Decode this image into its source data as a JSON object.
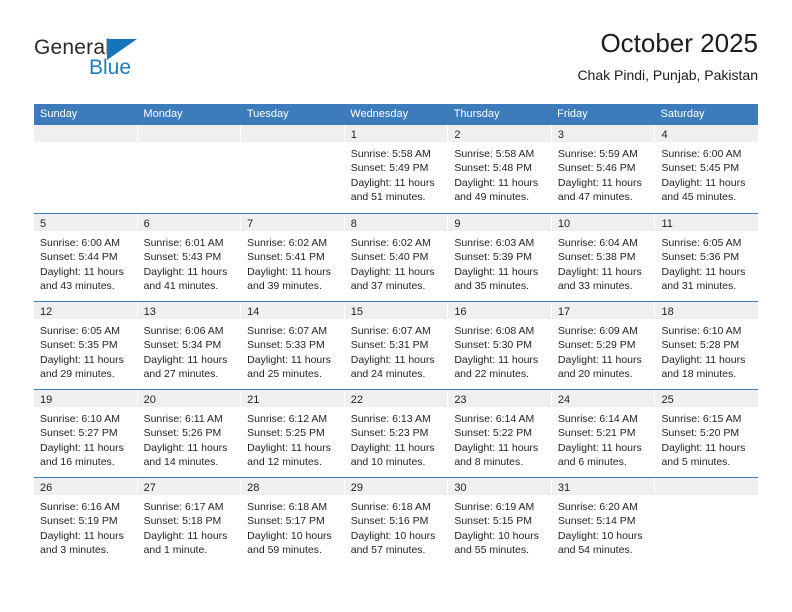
{
  "brand": {
    "line1": "General",
    "line2": "Blue",
    "triangle_color": "#1574bb",
    "blue_color": "#1a7fc1"
  },
  "header": {
    "title": "October 2025",
    "subtitle": "Chak Pindi, Punjab, Pakistan"
  },
  "theme": {
    "header_row_bg": "#3d7cba",
    "day_number_bg": "#efefef",
    "week_divider": "#3d7cba",
    "text": "#231f20"
  },
  "weekdays": [
    "Sunday",
    "Monday",
    "Tuesday",
    "Wednesday",
    "Thursday",
    "Friday",
    "Saturday"
  ],
  "weeks": [
    [
      {
        "day": "",
        "sunrise": "",
        "sunset": "",
        "daylight1": "",
        "daylight2": ""
      },
      {
        "day": "",
        "sunrise": "",
        "sunset": "",
        "daylight1": "",
        "daylight2": ""
      },
      {
        "day": "",
        "sunrise": "",
        "sunset": "",
        "daylight1": "",
        "daylight2": ""
      },
      {
        "day": "1",
        "sunrise": "Sunrise: 5:58 AM",
        "sunset": "Sunset: 5:49 PM",
        "daylight1": "Daylight: 11 hours",
        "daylight2": "and 51 minutes."
      },
      {
        "day": "2",
        "sunrise": "Sunrise: 5:58 AM",
        "sunset": "Sunset: 5:48 PM",
        "daylight1": "Daylight: 11 hours",
        "daylight2": "and 49 minutes."
      },
      {
        "day": "3",
        "sunrise": "Sunrise: 5:59 AM",
        "sunset": "Sunset: 5:46 PM",
        "daylight1": "Daylight: 11 hours",
        "daylight2": "and 47 minutes."
      },
      {
        "day": "4",
        "sunrise": "Sunrise: 6:00 AM",
        "sunset": "Sunset: 5:45 PM",
        "daylight1": "Daylight: 11 hours",
        "daylight2": "and 45 minutes."
      }
    ],
    [
      {
        "day": "5",
        "sunrise": "Sunrise: 6:00 AM",
        "sunset": "Sunset: 5:44 PM",
        "daylight1": "Daylight: 11 hours",
        "daylight2": "and 43 minutes."
      },
      {
        "day": "6",
        "sunrise": "Sunrise: 6:01 AM",
        "sunset": "Sunset: 5:43 PM",
        "daylight1": "Daylight: 11 hours",
        "daylight2": "and 41 minutes."
      },
      {
        "day": "7",
        "sunrise": "Sunrise: 6:02 AM",
        "sunset": "Sunset: 5:41 PM",
        "daylight1": "Daylight: 11 hours",
        "daylight2": "and 39 minutes."
      },
      {
        "day": "8",
        "sunrise": "Sunrise: 6:02 AM",
        "sunset": "Sunset: 5:40 PM",
        "daylight1": "Daylight: 11 hours",
        "daylight2": "and 37 minutes."
      },
      {
        "day": "9",
        "sunrise": "Sunrise: 6:03 AM",
        "sunset": "Sunset: 5:39 PM",
        "daylight1": "Daylight: 11 hours",
        "daylight2": "and 35 minutes."
      },
      {
        "day": "10",
        "sunrise": "Sunrise: 6:04 AM",
        "sunset": "Sunset: 5:38 PM",
        "daylight1": "Daylight: 11 hours",
        "daylight2": "and 33 minutes."
      },
      {
        "day": "11",
        "sunrise": "Sunrise: 6:05 AM",
        "sunset": "Sunset: 5:36 PM",
        "daylight1": "Daylight: 11 hours",
        "daylight2": "and 31 minutes."
      }
    ],
    [
      {
        "day": "12",
        "sunrise": "Sunrise: 6:05 AM",
        "sunset": "Sunset: 5:35 PM",
        "daylight1": "Daylight: 11 hours",
        "daylight2": "and 29 minutes."
      },
      {
        "day": "13",
        "sunrise": "Sunrise: 6:06 AM",
        "sunset": "Sunset: 5:34 PM",
        "daylight1": "Daylight: 11 hours",
        "daylight2": "and 27 minutes."
      },
      {
        "day": "14",
        "sunrise": "Sunrise: 6:07 AM",
        "sunset": "Sunset: 5:33 PM",
        "daylight1": "Daylight: 11 hours",
        "daylight2": "and 25 minutes."
      },
      {
        "day": "15",
        "sunrise": "Sunrise: 6:07 AM",
        "sunset": "Sunset: 5:31 PM",
        "daylight1": "Daylight: 11 hours",
        "daylight2": "and 24 minutes."
      },
      {
        "day": "16",
        "sunrise": "Sunrise: 6:08 AM",
        "sunset": "Sunset: 5:30 PM",
        "daylight1": "Daylight: 11 hours",
        "daylight2": "and 22 minutes."
      },
      {
        "day": "17",
        "sunrise": "Sunrise: 6:09 AM",
        "sunset": "Sunset: 5:29 PM",
        "daylight1": "Daylight: 11 hours",
        "daylight2": "and 20 minutes."
      },
      {
        "day": "18",
        "sunrise": "Sunrise: 6:10 AM",
        "sunset": "Sunset: 5:28 PM",
        "daylight1": "Daylight: 11 hours",
        "daylight2": "and 18 minutes."
      }
    ],
    [
      {
        "day": "19",
        "sunrise": "Sunrise: 6:10 AM",
        "sunset": "Sunset: 5:27 PM",
        "daylight1": "Daylight: 11 hours",
        "daylight2": "and 16 minutes."
      },
      {
        "day": "20",
        "sunrise": "Sunrise: 6:11 AM",
        "sunset": "Sunset: 5:26 PM",
        "daylight1": "Daylight: 11 hours",
        "daylight2": "and 14 minutes."
      },
      {
        "day": "21",
        "sunrise": "Sunrise: 6:12 AM",
        "sunset": "Sunset: 5:25 PM",
        "daylight1": "Daylight: 11 hours",
        "daylight2": "and 12 minutes."
      },
      {
        "day": "22",
        "sunrise": "Sunrise: 6:13 AM",
        "sunset": "Sunset: 5:23 PM",
        "daylight1": "Daylight: 11 hours",
        "daylight2": "and 10 minutes."
      },
      {
        "day": "23",
        "sunrise": "Sunrise: 6:14 AM",
        "sunset": "Sunset: 5:22 PM",
        "daylight1": "Daylight: 11 hours",
        "daylight2": "and 8 minutes."
      },
      {
        "day": "24",
        "sunrise": "Sunrise: 6:14 AM",
        "sunset": "Sunset: 5:21 PM",
        "daylight1": "Daylight: 11 hours",
        "daylight2": "and 6 minutes."
      },
      {
        "day": "25",
        "sunrise": "Sunrise: 6:15 AM",
        "sunset": "Sunset: 5:20 PM",
        "daylight1": "Daylight: 11 hours",
        "daylight2": "and 5 minutes."
      }
    ],
    [
      {
        "day": "26",
        "sunrise": "Sunrise: 6:16 AM",
        "sunset": "Sunset: 5:19 PM",
        "daylight1": "Daylight: 11 hours",
        "daylight2": "and 3 minutes."
      },
      {
        "day": "27",
        "sunrise": "Sunrise: 6:17 AM",
        "sunset": "Sunset: 5:18 PM",
        "daylight1": "Daylight: 11 hours",
        "daylight2": "and 1 minute."
      },
      {
        "day": "28",
        "sunrise": "Sunrise: 6:18 AM",
        "sunset": "Sunset: 5:17 PM",
        "daylight1": "Daylight: 10 hours",
        "daylight2": "and 59 minutes."
      },
      {
        "day": "29",
        "sunrise": "Sunrise: 6:18 AM",
        "sunset": "Sunset: 5:16 PM",
        "daylight1": "Daylight: 10 hours",
        "daylight2": "and 57 minutes."
      },
      {
        "day": "30",
        "sunrise": "Sunrise: 6:19 AM",
        "sunset": "Sunset: 5:15 PM",
        "daylight1": "Daylight: 10 hours",
        "daylight2": "and 55 minutes."
      },
      {
        "day": "31",
        "sunrise": "Sunrise: 6:20 AM",
        "sunset": "Sunset: 5:14 PM",
        "daylight1": "Daylight: 10 hours",
        "daylight2": "and 54 minutes."
      },
      {
        "day": "",
        "sunrise": "",
        "sunset": "",
        "daylight1": "",
        "daylight2": ""
      }
    ]
  ]
}
